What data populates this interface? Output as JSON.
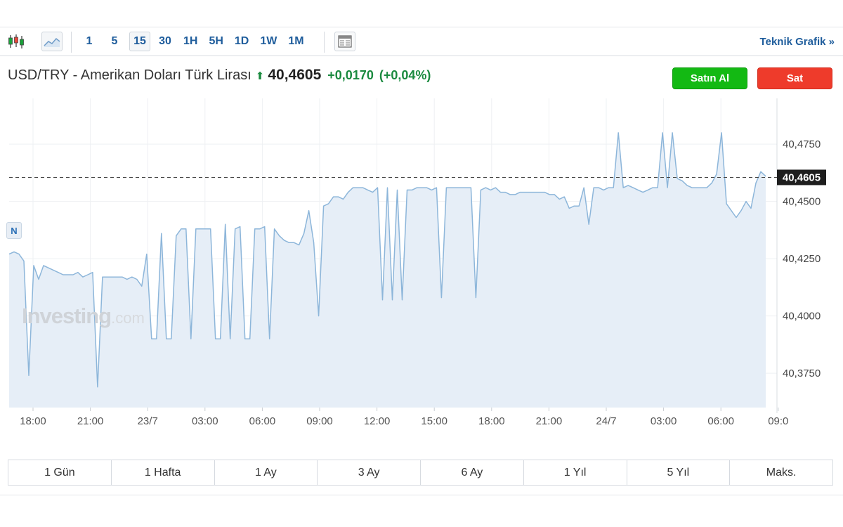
{
  "toolbar": {
    "intervals": [
      "1",
      "5",
      "15",
      "30",
      "1H",
      "5H",
      "1D",
      "1W",
      "1M"
    ],
    "active_interval": "15",
    "teknik_label": "Teknik Grafik",
    "teknik_arrow": "»"
  },
  "header": {
    "instrument": "USD/TRY - Amerikan Doları Türk Lirası",
    "price": "40,4605",
    "change": "+0,0170",
    "change_pct": "(+0,04%)"
  },
  "buttons": {
    "buy": "Satın Al",
    "sell": "Sat"
  },
  "watermark": {
    "brand": "Investing",
    "suffix": ".com"
  },
  "marker_label": "N",
  "colors": {
    "up": "#1a8a3f",
    "line": "#8db6da",
    "fill": "#e6eef7",
    "buy": "#13b913",
    "sell": "#ee3b2b",
    "link": "#1f5d9c"
  },
  "periods": [
    "1 Gün",
    "1 Hafta",
    "1 Ay",
    "3 Ay",
    "6 Ay",
    "1 Yıl",
    "5 Yıl",
    "Maks."
  ],
  "chart_data": {
    "type": "area",
    "title": "",
    "xlabel": "",
    "ylabel": "",
    "ylim": [
      40.36,
      40.495
    ],
    "x_ticks": [
      "18:00",
      "21:00",
      "23/7",
      "03:00",
      "06:00",
      "09:00",
      "12:00",
      "15:00",
      "18:00",
      "21:00",
      "24/7",
      "03:00",
      "06:00",
      "09:0"
    ],
    "y_ticks": [
      "40,4750",
      "40,4500",
      "40,4250",
      "40,4000",
      "40,3750"
    ],
    "y_tick_values": [
      40.475,
      40.45,
      40.425,
      40.4,
      40.375
    ],
    "current_price_label": "40,4605",
    "current_price": 40.4605,
    "grid": true,
    "series": [
      {
        "values": [
          40.427,
          40.428,
          40.427,
          40.424,
          40.374,
          40.422,
          40.416,
          40.422,
          40.421,
          40.42,
          40.419,
          40.418,
          40.418,
          40.418,
          40.419,
          40.417,
          40.418,
          40.419,
          40.369,
          40.417,
          40.417,
          40.417,
          40.417,
          40.417,
          40.416,
          40.417,
          40.416,
          40.413,
          40.427,
          40.39,
          40.39,
          40.436,
          40.39,
          40.39,
          40.435,
          40.438,
          40.438,
          40.39,
          40.438,
          40.438,
          40.438,
          40.438,
          40.39,
          40.39,
          40.44,
          40.39,
          40.438,
          40.439,
          40.39,
          40.39,
          40.438,
          40.438,
          40.439,
          40.39,
          40.438,
          40.435,
          40.433,
          40.432,
          40.432,
          40.431,
          40.436,
          40.446,
          40.432,
          40.4,
          40.448,
          40.449,
          40.452,
          40.452,
          40.451,
          40.454,
          40.456,
          40.456,
          40.456,
          40.455,
          40.454,
          40.456,
          40.407,
          40.456,
          40.407,
          40.455,
          40.407,
          40.455,
          40.455,
          40.456,
          40.456,
          40.456,
          40.455,
          40.456,
          40.408,
          40.456,
          40.456,
          40.456,
          40.456,
          40.456,
          40.456,
          40.408,
          40.455,
          40.456,
          40.455,
          40.456,
          40.454,
          40.454,
          40.453,
          40.453,
          40.454,
          40.454,
          40.454,
          40.454,
          40.454,
          40.454,
          40.453,
          40.453,
          40.451,
          40.452,
          40.447,
          40.448,
          40.448,
          40.456,
          40.44,
          40.456,
          40.456,
          40.455,
          40.456,
          40.456,
          40.48,
          40.456,
          40.457,
          40.456,
          40.455,
          40.454,
          40.455,
          40.456,
          40.456,
          40.48,
          40.456,
          40.48,
          40.46,
          40.459,
          40.457,
          40.456,
          40.456,
          40.456,
          40.456,
          40.458,
          40.462,
          40.48,
          40.449,
          40.446,
          40.443,
          40.446,
          40.45,
          40.447,
          40.458,
          40.463,
          40.461
        ]
      }
    ]
  }
}
